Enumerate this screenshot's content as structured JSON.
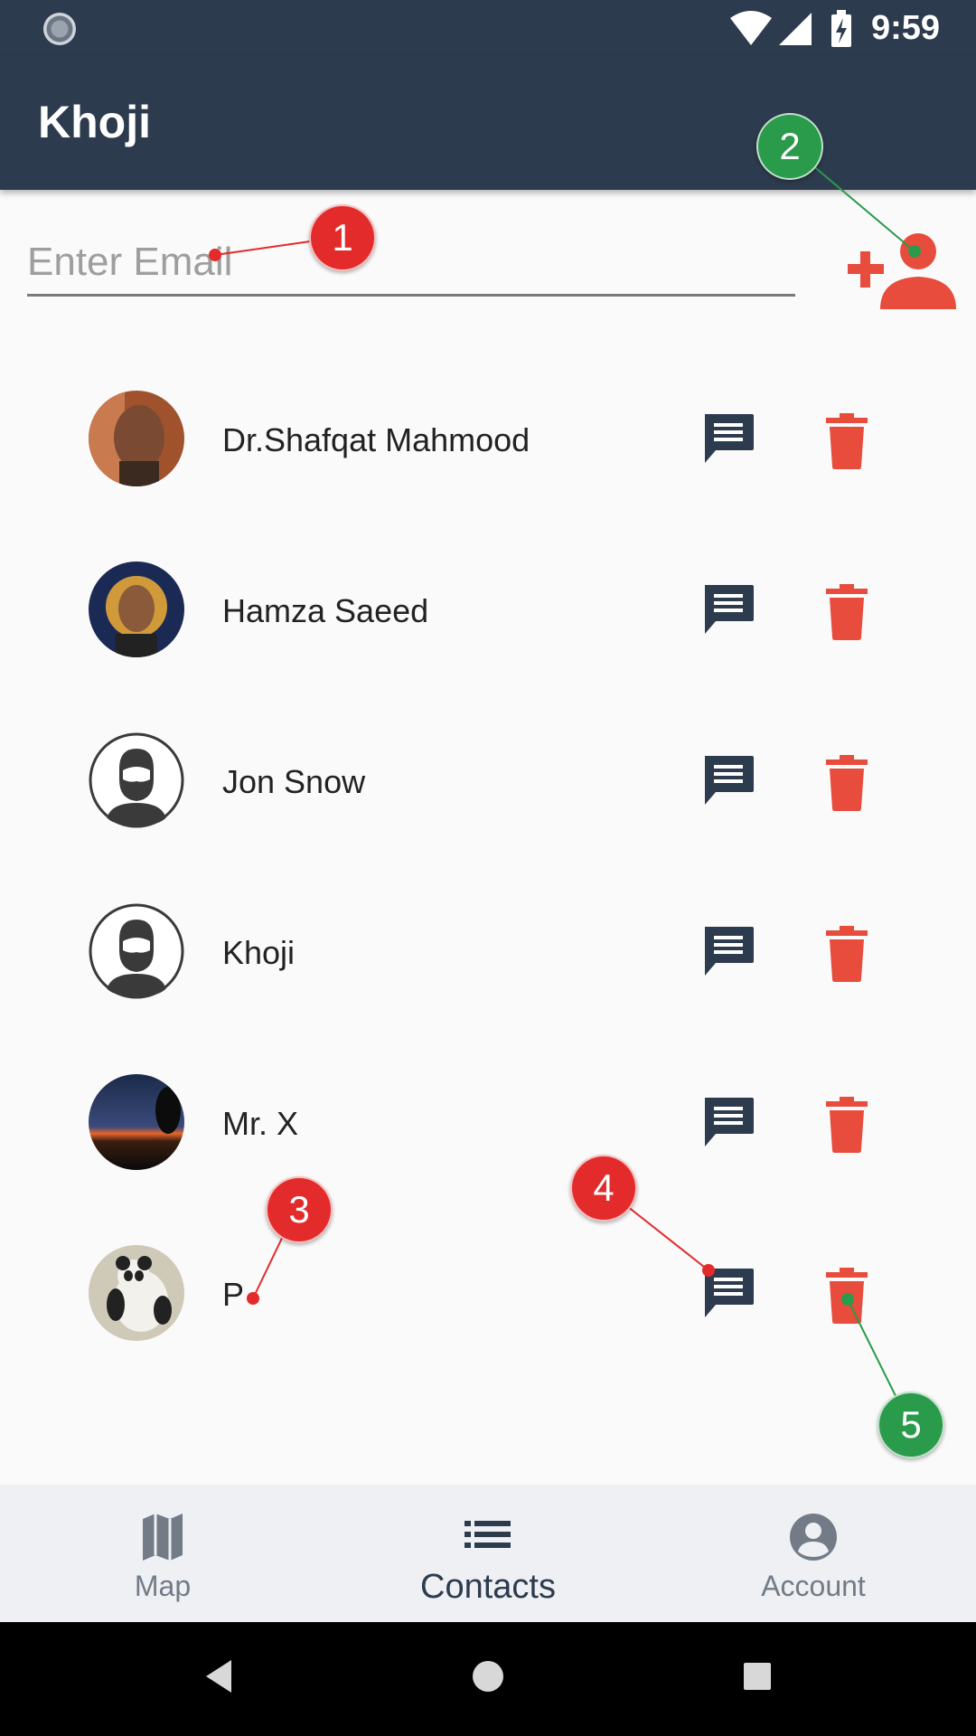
{
  "status_bar": {
    "time": "9:59"
  },
  "app_bar": {
    "title": "Khoji"
  },
  "email_input": {
    "placeholder": "Enter Email",
    "value": ""
  },
  "contacts": [
    {
      "name": "Dr.Shafqat Mahmood",
      "avatar": "photo"
    },
    {
      "name": "Hamza Saeed",
      "avatar": "photo"
    },
    {
      "name": "Jon Snow",
      "avatar": "default-bearded-man"
    },
    {
      "name": "Khoji",
      "avatar": "default-bearded-man"
    },
    {
      "name": "Mr. X",
      "avatar": "sunset-photo"
    },
    {
      "name": "P",
      "avatar": "panda-photo"
    }
  ],
  "markers": [
    "1",
    "2",
    "3",
    "4",
    "5"
  ],
  "bottom_nav": {
    "items": [
      {
        "label": "Map",
        "icon": "map-icon",
        "active": false
      },
      {
        "label": "Contacts",
        "icon": "list-icon",
        "active": true
      },
      {
        "label": "Account",
        "icon": "account-circle-icon",
        "active": false
      }
    ]
  },
  "colors": {
    "primary": "#2d3b4e",
    "accent_red": "#e74c3c",
    "marker_red": "#e32b2b",
    "marker_green": "#2a9a4b"
  }
}
